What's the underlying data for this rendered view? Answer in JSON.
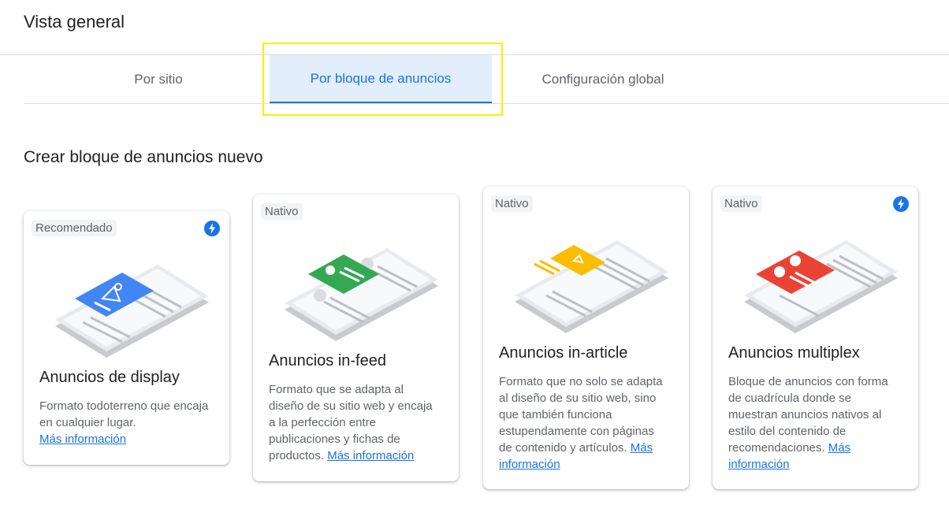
{
  "header": {
    "title": "Vista general"
  },
  "tabs": [
    {
      "label": "Por sitio",
      "selected": false
    },
    {
      "label": "Por bloque de anuncios",
      "selected": true
    },
    {
      "label": "Configuración global",
      "selected": false
    }
  ],
  "section": {
    "title": "Crear bloque de anuncios nuevo"
  },
  "cards": [
    {
      "badge": "Recomendado",
      "has_bolt": true,
      "illustration": "display-ad",
      "title": "Anuncios de display",
      "description": "Formato todoterreno que encaja en cualquier lugar.",
      "link": "Más información"
    },
    {
      "badge": "Nativo",
      "has_bolt": false,
      "illustration": "in-feed-ad",
      "title": "Anuncios in-feed",
      "description": "Formato que se adapta al diseño de su sitio web y encaja a la perfección entre publicaciones y fichas de productos.",
      "link": "Más información"
    },
    {
      "badge": "Nativo",
      "has_bolt": false,
      "illustration": "in-article-ad",
      "title": "Anuncios in-article",
      "description": "Formato que no solo se adapta al diseño de su sitio web, sino que también funciona estupendamente con páginas de contenido y artículos.",
      "link": "Más información"
    },
    {
      "badge": "Nativo",
      "has_bolt": true,
      "illustration": "multiplex-ad",
      "title": "Anuncios multiplex",
      "description": "Bloque de anuncios con forma de cuadrícula donde se muestran anuncios nativos al estilo del contenido de recomendaciones.",
      "link": "Más información"
    }
  ],
  "colors": {
    "accent": "#1a73e8",
    "highlight": "#ffee00",
    "display": "#4285f4",
    "infeed": "#34a853",
    "inarticle": "#fbbc04",
    "multiplex": "#ea4335"
  }
}
